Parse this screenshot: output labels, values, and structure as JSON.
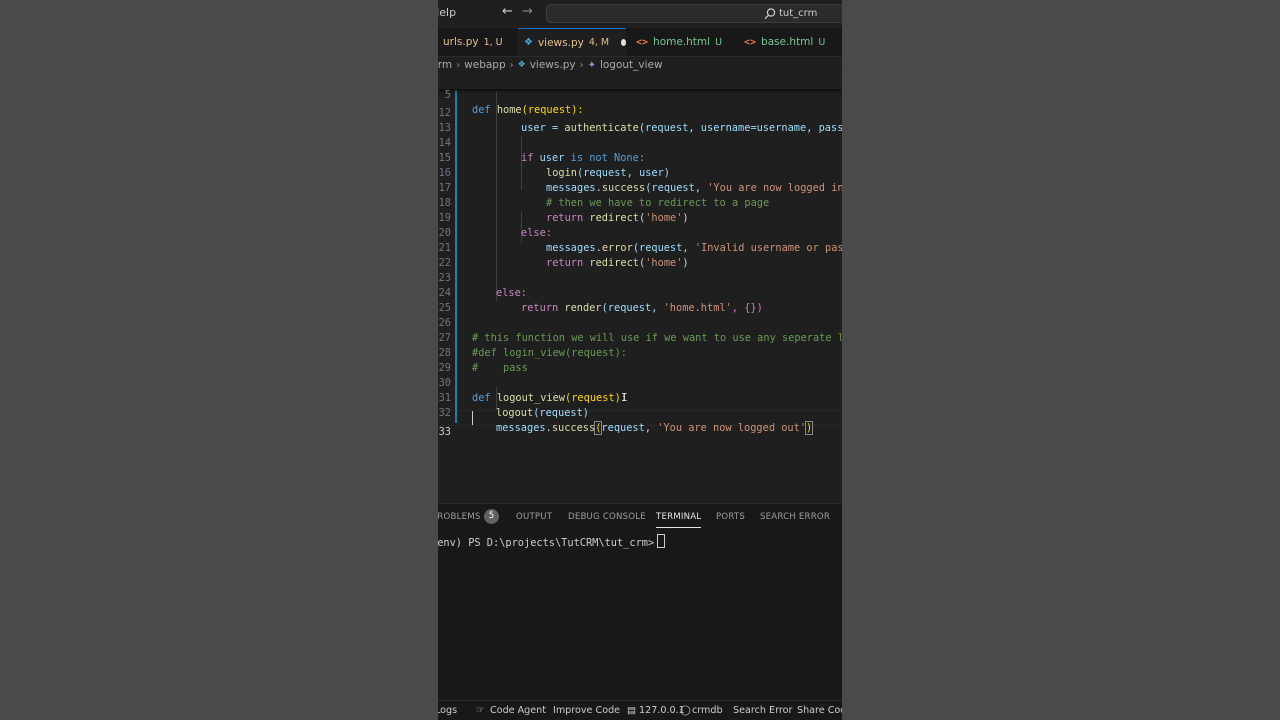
{
  "titlebar": {
    "menu_help": "Help",
    "search_text": "tut_crm"
  },
  "tabs": [
    {
      "name": "urls.py",
      "status": "1, U"
    },
    {
      "name": "views.py",
      "status": "4, M"
    },
    {
      "name": "home.html",
      "status": "U"
    },
    {
      "name": "base.html",
      "status": "U"
    }
  ],
  "breadcrumb": [
    "crm",
    "webapp",
    "views.py",
    "logout_view"
  ],
  "editor": {
    "sticky_line_number": "5",
    "line_numbers": [
      "12",
      "13",
      "14",
      "15",
      "16",
      "17",
      "18",
      "19",
      "20",
      "21",
      "22",
      "23",
      "24",
      "25",
      "26",
      "27",
      "28",
      "29",
      "30",
      "31",
      "32",
      "33"
    ],
    "code": {
      "l12": {
        "a": "user = ",
        "b": "authenticate",
        "c": "(request, username=username, passw"
      },
      "l14": {
        "a": "if",
        "b": "user",
        "c": "is not",
        "d": "None:"
      },
      "l15": {
        "a": "login",
        "b": "(request, user)"
      },
      "l16": {
        "a": "messages",
        "b": "success",
        "c": "(request, ",
        "d": "'You are now logged in"
      },
      "l17": "# then we have to redirect to a page",
      "l18": {
        "a": "return",
        "b": "redirect",
        "c": "'home'"
      },
      "l19": "else:",
      "l20": {
        "a": "messages",
        "b": "error",
        "c": "(request, ",
        "d": "'Invalid username or pas"
      },
      "l21": {
        "a": "return",
        "b": "redirect",
        "c": "'home'"
      },
      "l23": "else:",
      "l24": {
        "a": "return",
        "b": "render",
        "c": "(request, ",
        "d": "'home.html'",
        "e": ", {})"
      },
      "l26": "# this function we will use if we want to use any seperate lo",
      "l27": "#def login_view(request):",
      "l28": "#    pass",
      "l30": {
        "a": "def",
        "b": "logout_view",
        "c": "(request):"
      },
      "l31": {
        "a": "logout",
        "b": "(request)"
      },
      "l32": {
        "a": "messages",
        "b": "success",
        "c": "request",
        "d": "'You are now logged out'"
      },
      "sticky": {
        "a": "def",
        "b": "home",
        "c": "(request):"
      }
    }
  },
  "panel": {
    "tabs": [
      "PROBLEMS",
      "OUTPUT",
      "DEBUG CONSOLE",
      "TERMINAL",
      "PORTS",
      "SEARCH ERROR"
    ],
    "problems_count": "5",
    "terminal_prompt": "(env) PS D:\\projects\\TutCRM\\tut_crm>"
  },
  "statusbar": {
    "logs": "Logs",
    "code_agent": "Code Agent",
    "improve_code": "Improve Code",
    "server": "127.0.0.1",
    "db": "crmdb",
    "search_error": "Search Error",
    "share_code": "Share Code"
  },
  "colors": {
    "editor_bg": "#1f1f1f",
    "accent": "#0078d4",
    "modified": "#e2c08d",
    "untracked": "#73c991"
  }
}
